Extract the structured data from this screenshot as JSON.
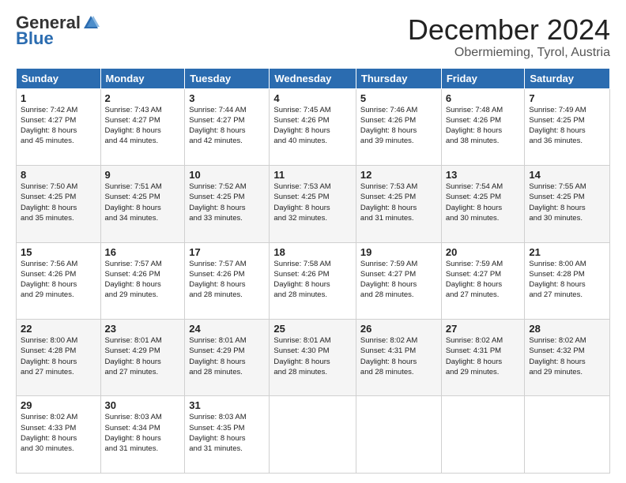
{
  "logo": {
    "general": "General",
    "blue": "Blue"
  },
  "title": "December 2024",
  "subtitle": "Obermieming, Tyrol, Austria",
  "days_header": [
    "Sunday",
    "Monday",
    "Tuesday",
    "Wednesday",
    "Thursday",
    "Friday",
    "Saturday"
  ],
  "weeks": [
    [
      {
        "day": "1",
        "info": "Sunrise: 7:42 AM\nSunset: 4:27 PM\nDaylight: 8 hours\nand 45 minutes."
      },
      {
        "day": "2",
        "info": "Sunrise: 7:43 AM\nSunset: 4:27 PM\nDaylight: 8 hours\nand 44 minutes."
      },
      {
        "day": "3",
        "info": "Sunrise: 7:44 AM\nSunset: 4:27 PM\nDaylight: 8 hours\nand 42 minutes."
      },
      {
        "day": "4",
        "info": "Sunrise: 7:45 AM\nSunset: 4:26 PM\nDaylight: 8 hours\nand 40 minutes."
      },
      {
        "day": "5",
        "info": "Sunrise: 7:46 AM\nSunset: 4:26 PM\nDaylight: 8 hours\nand 39 minutes."
      },
      {
        "day": "6",
        "info": "Sunrise: 7:48 AM\nSunset: 4:26 PM\nDaylight: 8 hours\nand 38 minutes."
      },
      {
        "day": "7",
        "info": "Sunrise: 7:49 AM\nSunset: 4:25 PM\nDaylight: 8 hours\nand 36 minutes."
      }
    ],
    [
      {
        "day": "8",
        "info": "Sunrise: 7:50 AM\nSunset: 4:25 PM\nDaylight: 8 hours\nand 35 minutes."
      },
      {
        "day": "9",
        "info": "Sunrise: 7:51 AM\nSunset: 4:25 PM\nDaylight: 8 hours\nand 34 minutes."
      },
      {
        "day": "10",
        "info": "Sunrise: 7:52 AM\nSunset: 4:25 PM\nDaylight: 8 hours\nand 33 minutes."
      },
      {
        "day": "11",
        "info": "Sunrise: 7:53 AM\nSunset: 4:25 PM\nDaylight: 8 hours\nand 32 minutes."
      },
      {
        "day": "12",
        "info": "Sunrise: 7:53 AM\nSunset: 4:25 PM\nDaylight: 8 hours\nand 31 minutes."
      },
      {
        "day": "13",
        "info": "Sunrise: 7:54 AM\nSunset: 4:25 PM\nDaylight: 8 hours\nand 30 minutes."
      },
      {
        "day": "14",
        "info": "Sunrise: 7:55 AM\nSunset: 4:25 PM\nDaylight: 8 hours\nand 30 minutes."
      }
    ],
    [
      {
        "day": "15",
        "info": "Sunrise: 7:56 AM\nSunset: 4:26 PM\nDaylight: 8 hours\nand 29 minutes."
      },
      {
        "day": "16",
        "info": "Sunrise: 7:57 AM\nSunset: 4:26 PM\nDaylight: 8 hours\nand 29 minutes."
      },
      {
        "day": "17",
        "info": "Sunrise: 7:57 AM\nSunset: 4:26 PM\nDaylight: 8 hours\nand 28 minutes."
      },
      {
        "day": "18",
        "info": "Sunrise: 7:58 AM\nSunset: 4:26 PM\nDaylight: 8 hours\nand 28 minutes."
      },
      {
        "day": "19",
        "info": "Sunrise: 7:59 AM\nSunset: 4:27 PM\nDaylight: 8 hours\nand 28 minutes."
      },
      {
        "day": "20",
        "info": "Sunrise: 7:59 AM\nSunset: 4:27 PM\nDaylight: 8 hours\nand 27 minutes."
      },
      {
        "day": "21",
        "info": "Sunrise: 8:00 AM\nSunset: 4:28 PM\nDaylight: 8 hours\nand 27 minutes."
      }
    ],
    [
      {
        "day": "22",
        "info": "Sunrise: 8:00 AM\nSunset: 4:28 PM\nDaylight: 8 hours\nand 27 minutes."
      },
      {
        "day": "23",
        "info": "Sunrise: 8:01 AM\nSunset: 4:29 PM\nDaylight: 8 hours\nand 27 minutes."
      },
      {
        "day": "24",
        "info": "Sunrise: 8:01 AM\nSunset: 4:29 PM\nDaylight: 8 hours\nand 28 minutes."
      },
      {
        "day": "25",
        "info": "Sunrise: 8:01 AM\nSunset: 4:30 PM\nDaylight: 8 hours\nand 28 minutes."
      },
      {
        "day": "26",
        "info": "Sunrise: 8:02 AM\nSunset: 4:31 PM\nDaylight: 8 hours\nand 28 minutes."
      },
      {
        "day": "27",
        "info": "Sunrise: 8:02 AM\nSunset: 4:31 PM\nDaylight: 8 hours\nand 29 minutes."
      },
      {
        "day": "28",
        "info": "Sunrise: 8:02 AM\nSunset: 4:32 PM\nDaylight: 8 hours\nand 29 minutes."
      }
    ],
    [
      {
        "day": "29",
        "info": "Sunrise: 8:02 AM\nSunset: 4:33 PM\nDaylight: 8 hours\nand 30 minutes."
      },
      {
        "day": "30",
        "info": "Sunrise: 8:03 AM\nSunset: 4:34 PM\nDaylight: 8 hours\nand 31 minutes."
      },
      {
        "day": "31",
        "info": "Sunrise: 8:03 AM\nSunset: 4:35 PM\nDaylight: 8 hours\nand 31 minutes."
      },
      {
        "day": "",
        "info": ""
      },
      {
        "day": "",
        "info": ""
      },
      {
        "day": "",
        "info": ""
      },
      {
        "day": "",
        "info": ""
      }
    ]
  ]
}
